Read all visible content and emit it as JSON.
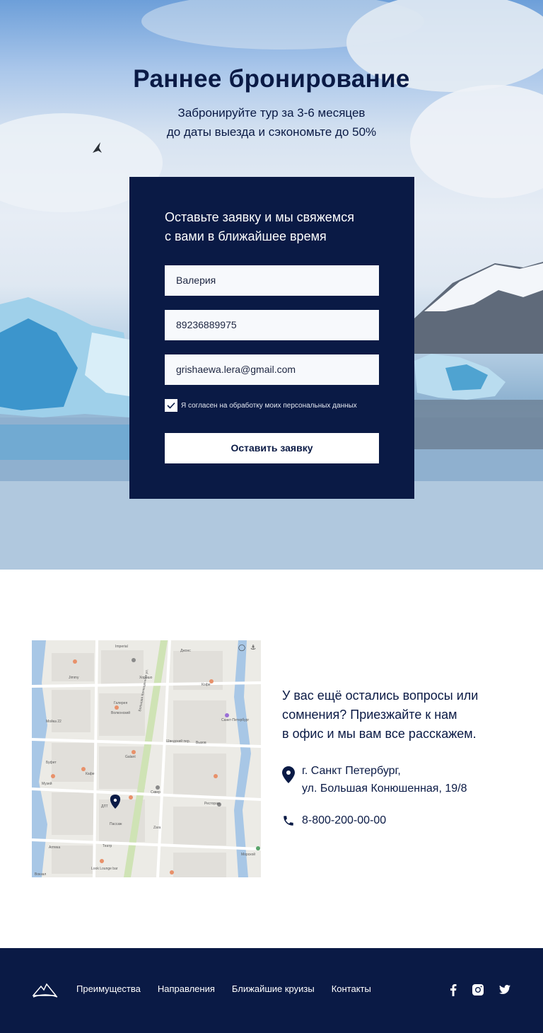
{
  "hero": {
    "title": "Раннее бронирование",
    "subtitle_line1": "Забронируйте тур за 3-6 месяцев",
    "subtitle_line2": "до даты выезда и сэкономьте до 50%"
  },
  "form": {
    "heading_line1": "Оставьте заявку и мы свяжемся",
    "heading_line2": "с вами в ближайшее время",
    "name_value": "Валерия",
    "phone_value": "89236889975",
    "email_value": "grishaewa.lera@gmail.com",
    "consent_label": "Я согласен на обработку моих персональных данных",
    "consent_checked": true,
    "submit_label": "Оставить заявку"
  },
  "contacts": {
    "text_line1": "У вас ещё остались вопросы или",
    "text_line2": "сомнения? Приезжайте к нам",
    "text_line3": "в офис и мы вам все расскажем.",
    "address_line1": "г. Санкт Петербург,",
    "address_line2": "ул. Большая Конюшенная, 19/8",
    "phone": "8-800-200-00-00"
  },
  "map": {
    "labels": [
      "Imperial",
      "Хорошо",
      "Джонс",
      "Кофе",
      "Волконский",
      "Jimmy",
      "Galant",
      "Санкт-Петербург",
      "Буфет",
      "Вызов",
      "ДЛТ",
      "Пассаж",
      "Zara",
      "Большая Конюшенная ул.",
      "Шведский пер.",
      "Мойка 22",
      "Музей",
      "Сквер",
      "Look Lounge bar",
      "Вокзал",
      "Кафе",
      "Ресторан",
      "Галерея",
      "Театр",
      "Морской",
      "Аптека"
    ]
  },
  "footer": {
    "nav": [
      "Преимущества",
      "Направления",
      "Ближайшие круизы",
      "Контакты"
    ],
    "social": [
      "facebook-icon",
      "instagram-icon",
      "twitter-icon"
    ]
  },
  "colors": {
    "navy": "#0a1a45",
    "white": "#ffffff",
    "field_bg": "#f7f9fc"
  }
}
